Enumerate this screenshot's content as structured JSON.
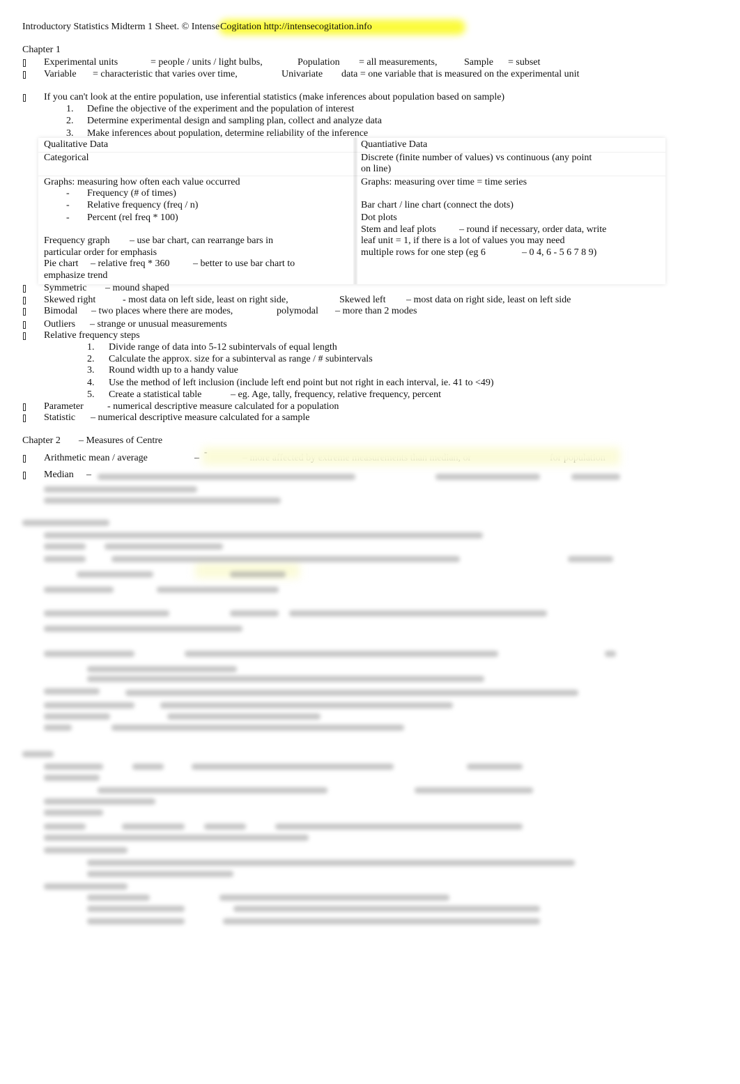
{
  "document": {
    "title": "Introductory Statistics Midterm 1 Sheet. © Intense ",
    "title_highlight": "Cogitation http://intensecogitation.info",
    "highlight_color": "#fbfb3c",
    "bullet_icon": "square-bullet-icon",
    "lines": [
      {
        "bullet": false,
        "segments": [
          "Chapter 1"
        ]
      },
      {
        "bullet": true,
        "segments": [
          "Experimental units",
          "= people / units / light bulbs,",
          "Population",
          "= all measurements,",
          "Sample",
          "= subset"
        ]
      },
      {
        "bullet": true,
        "segments": [
          "Variable",
          "= characteristic that varies over time,",
          "Univariate",
          "data = one variable that is measured on the experimental unit"
        ]
      },
      {
        "bullet": true,
        "segments": [
          "If you can't look at the entire population, use inferential statistics (make inferences about population based on sample)"
        ]
      },
      {
        "bullet": false,
        "segments": [
          "1.",
          "Define the objective of the experiment and the population of interest"
        ]
      },
      {
        "bullet": false,
        "segments": [
          "2.",
          "Determine experimental design and sampling plan, collect and analyze data"
        ]
      },
      {
        "bullet": false,
        "segments": [
          "3.",
          "Make inferences about population, determine reliability of the inference"
        ]
      },
      {
        "bullet": false,
        "segments": [
          "Qualitative Data",
          "Quantiative Data"
        ]
      },
      {
        "bullet": false,
        "segments": [
          "Categorical",
          "Discrete (finite number of values) vs continuous (any point"
        ]
      },
      {
        "bullet": false,
        "segments": [
          "on line)"
        ]
      },
      {
        "bullet": false,
        "segments": [
          "Graphs: measuring how often each value occurred",
          "Graphs: measuring over time = time series"
        ]
      },
      {
        "bullet": false,
        "segments": [
          "-",
          "Frequency (# of times)"
        ]
      },
      {
        "bullet": false,
        "segments": [
          "-",
          "Relative frequency (freq / n)",
          "Bar chart / line chart (connect the dots)"
        ]
      },
      {
        "bullet": false,
        "segments": [
          "-",
          "Percent (rel freq * 100)",
          "Dot plots"
        ]
      },
      {
        "bullet": false,
        "segments": [
          "Stem and leaf plots",
          "– round if necessary, order data, write"
        ]
      },
      {
        "bullet": false,
        "segments": [
          "Frequency graph",
          "– use bar chart, can rearrange bars in",
          "leaf unit = 1, if there is a lot of values you may need"
        ]
      },
      {
        "bullet": false,
        "segments": [
          "particular order for emphasis",
          "multiple rows for one step (eg 6",
          "– 0 4, 6 - 5 6 7 8 9)"
        ]
      },
      {
        "bullet": false,
        "segments": [
          "Pie chart",
          "– relative freq * 360",
          "– better to use bar chart to"
        ]
      },
      {
        "bullet": false,
        "segments": [
          "emphasize trend"
        ]
      },
      {
        "bullet": true,
        "segments": [
          "Symmetric",
          "– mound shaped"
        ]
      },
      {
        "bullet": true,
        "segments": [
          "Skewed right",
          "- most data on left side, least on right side,",
          "Skewed left",
          "– most data on right side, least on left side"
        ]
      },
      {
        "bullet": true,
        "segments": [
          "Bimodal",
          "– two places where there are modes,",
          "polymodal",
          "– more than 2 modes"
        ]
      },
      {
        "bullet": true,
        "segments": [
          "Outliers",
          "– strange or unusual measurements"
        ]
      },
      {
        "bullet": true,
        "segments": [
          "Relative frequency steps"
        ]
      },
      {
        "bullet": false,
        "segments": [
          "1.",
          "Divide range of data into 5-12 subintervals of equal length"
        ]
      },
      {
        "bullet": false,
        "segments": [
          "2.",
          "Calculate the approx. size for a subinterval as range / # subintervals"
        ]
      },
      {
        "bullet": false,
        "segments": [
          "3.",
          "Round width up to a handy value"
        ]
      },
      {
        "bullet": false,
        "segments": [
          "4.",
          "Use the method of left inclusion (include left end point but not right in each interval, ie. 41 to <49)"
        ]
      },
      {
        "bullet": false,
        "segments": [
          "5.",
          "Create a statistical table",
          "– eg. Age, tally, frequency, relative frequency, percent"
        ]
      },
      {
        "bullet": true,
        "segments": [
          "Parameter",
          "- numerical descriptive measure calculated for a population"
        ]
      },
      {
        "bullet": true,
        "segments": [
          "Statistic",
          "– numerical descriptive measure calculated for a sample"
        ]
      },
      {
        "bullet": false,
        "segments": [
          "Chapter 2",
          "– Measures of Centre"
        ]
      },
      {
        "bullet": true,
        "segments": [
          "Arithmetic mean / average",
          "–",
          "-",
          "– more affected by extreme measurements than median, or",
          "for population"
        ]
      },
      {
        "bullet": true,
        "segments": [
          "Median",
          "–"
        ]
      }
    ]
  }
}
